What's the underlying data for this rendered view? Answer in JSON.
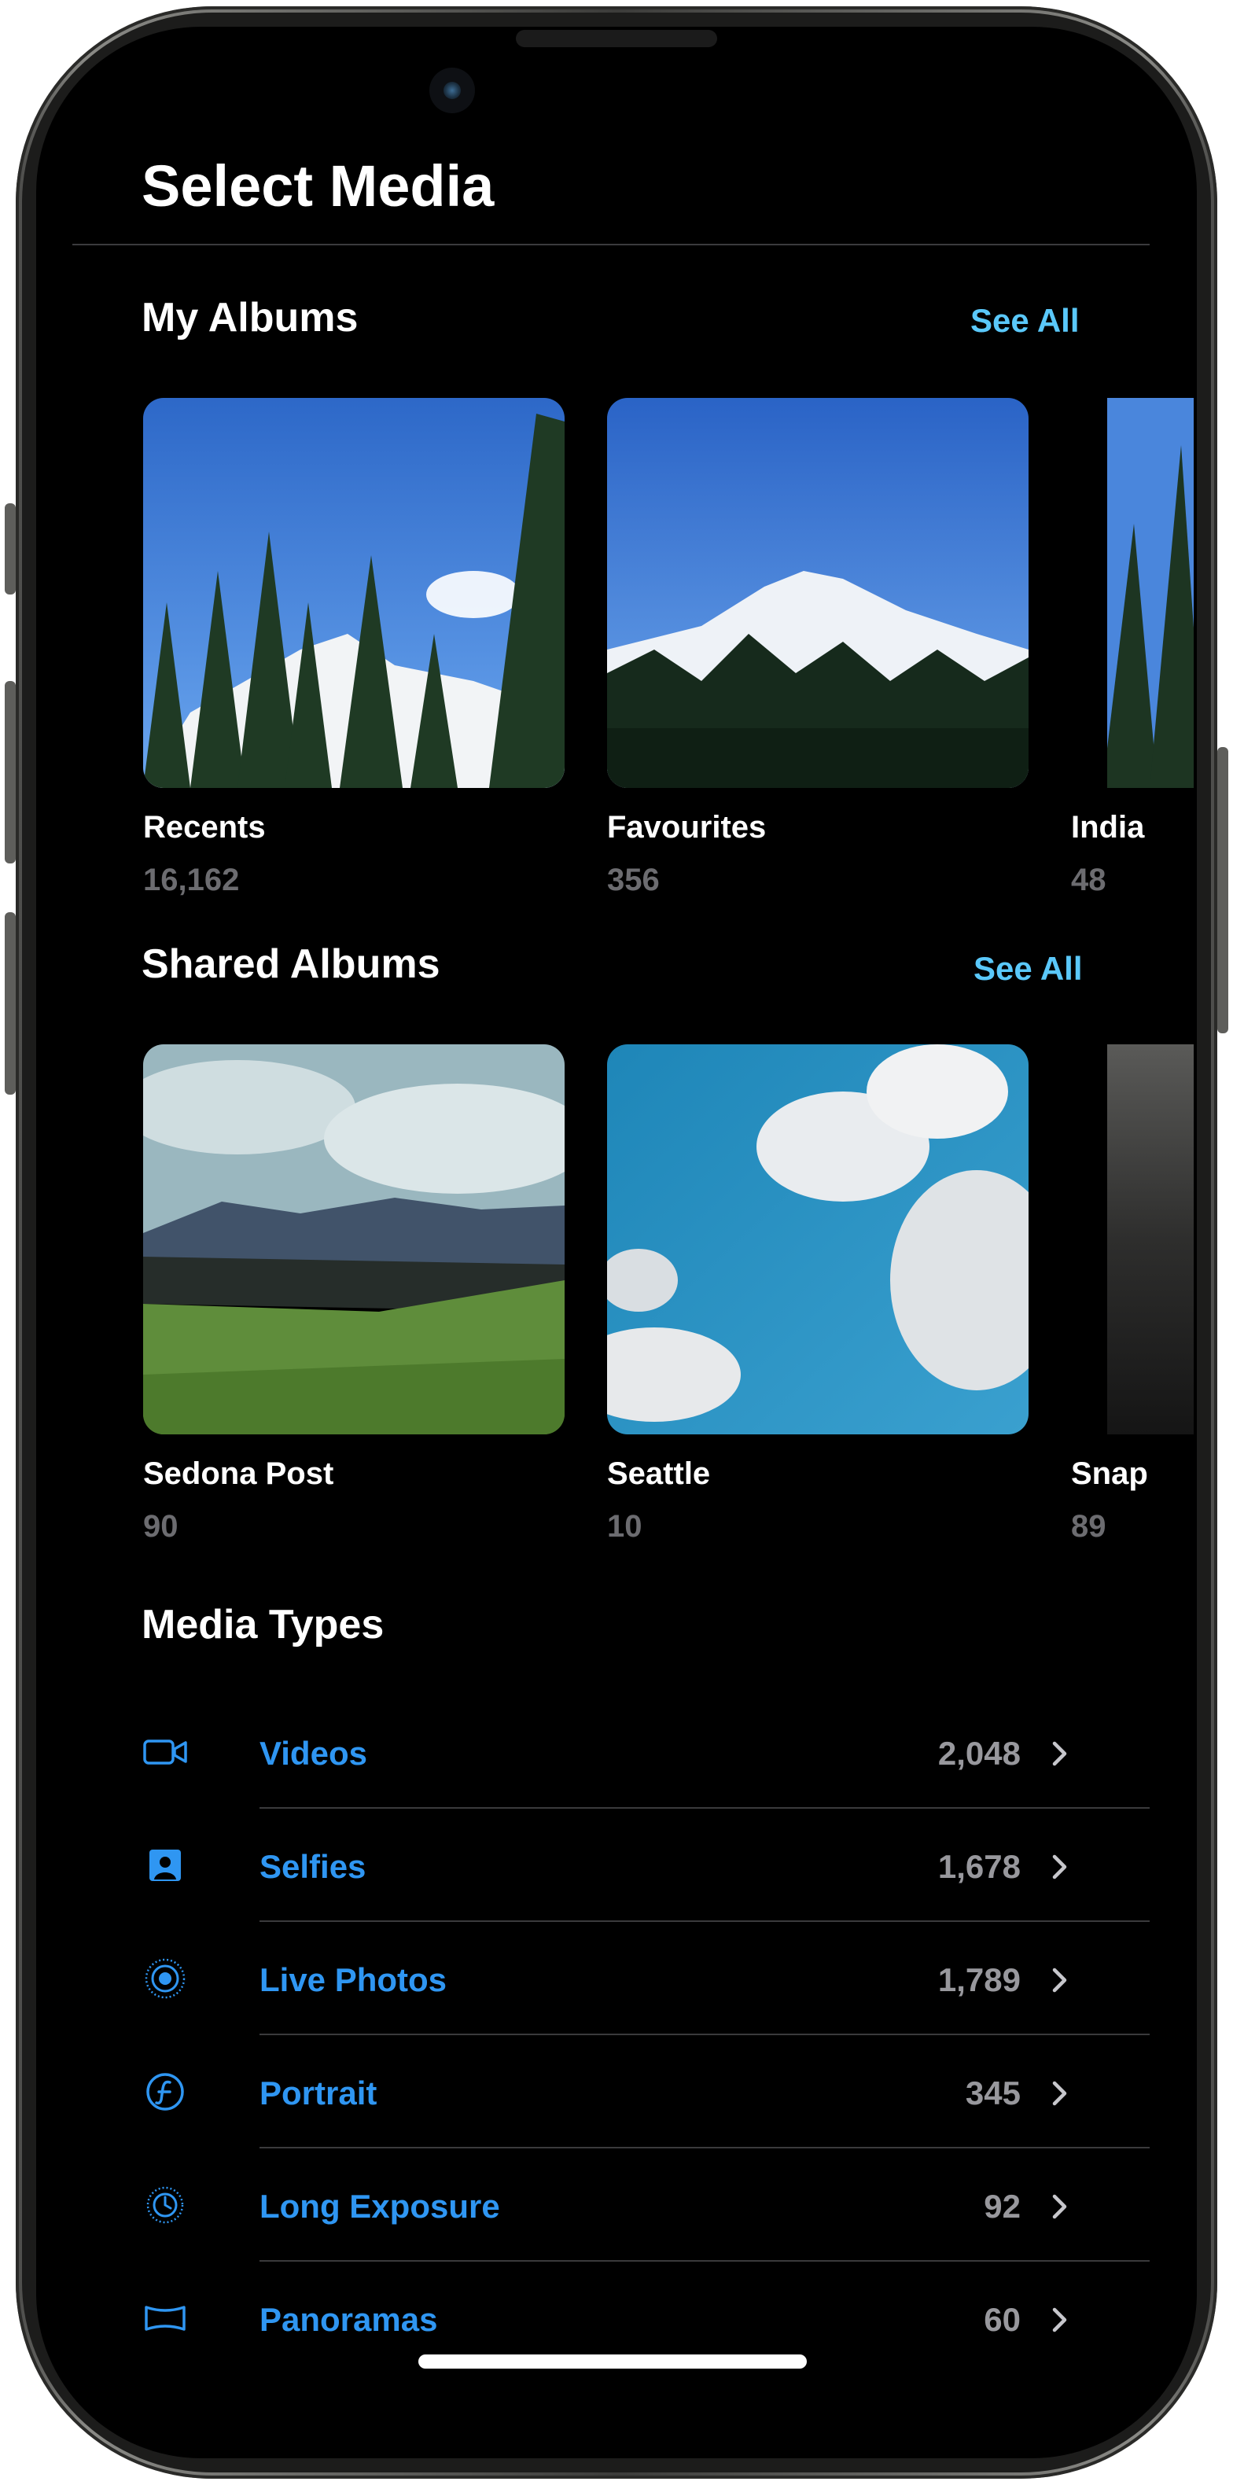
{
  "header": {
    "title": "Select Media"
  },
  "my_albums": {
    "heading": "My Albums",
    "see_all": "See All",
    "items": [
      {
        "name": "Recents",
        "count": "16,162"
      },
      {
        "name": "Favourites",
        "count": "356"
      },
      {
        "name": "India",
        "count": "48"
      }
    ]
  },
  "shared_albums": {
    "heading": "Shared Albums",
    "see_all": "See All",
    "items": [
      {
        "name": "Sedona Post",
        "count": "90"
      },
      {
        "name": "Seattle",
        "count": "10"
      },
      {
        "name": "Snap",
        "count": "89"
      }
    ]
  },
  "media_types": {
    "heading": "Media Types",
    "items": [
      {
        "label": "Videos",
        "count": "2,048",
        "icon": "video-camera-icon"
      },
      {
        "label": "Selfies",
        "count": "1,678",
        "icon": "selfie-portrait-icon"
      },
      {
        "label": "Live Photos",
        "count": "1,789",
        "icon": "live-photo-icon"
      },
      {
        "label": "Portrait",
        "count": "345",
        "icon": "aperture-f-icon"
      },
      {
        "label": "Long Exposure",
        "count": "92",
        "icon": "long-exposure-icon"
      },
      {
        "label": "Panoramas",
        "count": "60",
        "icon": "panorama-icon"
      }
    ]
  },
  "colors": {
    "accent": "#2f96f2",
    "see_all": "#5ac8fa",
    "background": "#000000",
    "count_gray": "#6c6c70"
  }
}
